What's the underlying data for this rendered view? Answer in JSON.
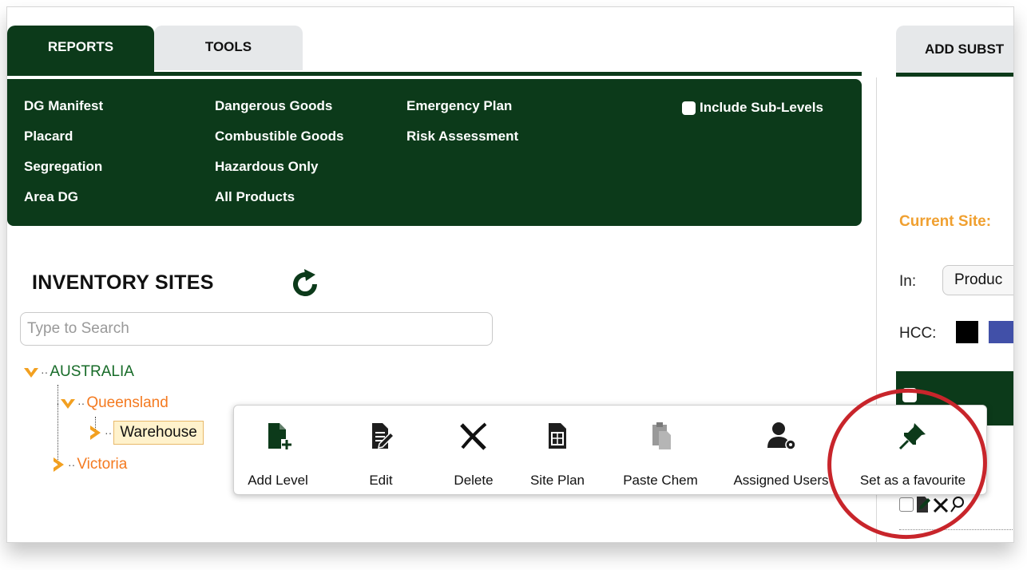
{
  "tabs": {
    "reports": "REPORTS",
    "tools": "TOOLS"
  },
  "reports": {
    "col1": [
      "DG Manifest",
      "Placard",
      "Segregation",
      "Area DG"
    ],
    "col2": [
      "Dangerous Goods",
      "Combustible Goods",
      "Hazardous Only",
      "All Products"
    ],
    "col3": [
      "Emergency Plan",
      "Risk Assessment"
    ],
    "include_sub_levels": "Include Sub-Levels",
    "include_sub_levels_checked": false
  },
  "inventory": {
    "title": "INVENTORY SITES",
    "refresh_icon": "refresh-icon",
    "search_placeholder": "Type to Search",
    "tree": {
      "root": "AUSTRALIA",
      "state1": "Queensland",
      "site1": "Warehouse",
      "state2": "Victoria"
    }
  },
  "right": {
    "tab_add": "ADD SUBST",
    "current_site": "Current Site:",
    "in_label": "In:",
    "in_value": "Produc",
    "hcc_label": "HCC:",
    "hcc_colors": [
      "#000000",
      "#4150a8"
    ]
  },
  "popup": {
    "add_level": "Add Level",
    "edit": "Edit",
    "delete": "Delete",
    "site_plan": "Site Plan",
    "paste_chem": "Paste Chem",
    "assigned_users": "Assigned Users",
    "set_favourite": "Set as a favourite"
  },
  "colors": {
    "dark_green": "#0c3a1a",
    "tree_green": "#176b28",
    "tree_orange": "#f47a20",
    "accent_orange": "#f0a030",
    "highlight_red": "#c8252b"
  }
}
